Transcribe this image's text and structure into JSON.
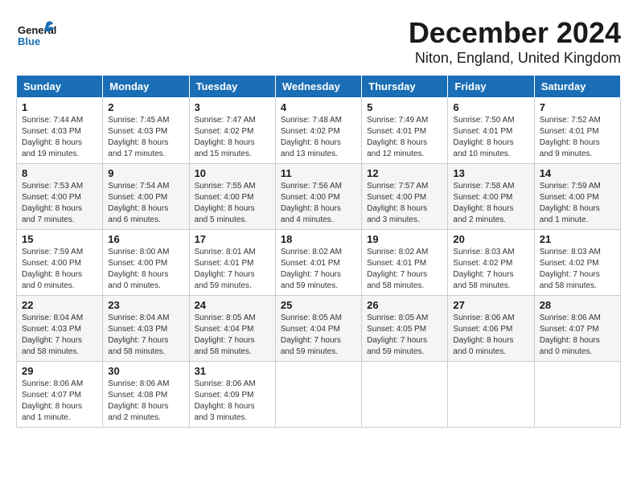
{
  "header": {
    "logo": {
      "general": "General",
      "blue": "Blue"
    },
    "month": "December 2024",
    "location": "Niton, England, United Kingdom"
  },
  "weekdays": [
    "Sunday",
    "Monday",
    "Tuesday",
    "Wednesday",
    "Thursday",
    "Friday",
    "Saturday"
  ],
  "weeks": [
    [
      {
        "day": "1",
        "sunrise": "Sunrise: 7:44 AM",
        "sunset": "Sunset: 4:03 PM",
        "daylight": "Daylight: 8 hours and 19 minutes."
      },
      {
        "day": "2",
        "sunrise": "Sunrise: 7:45 AM",
        "sunset": "Sunset: 4:03 PM",
        "daylight": "Daylight: 8 hours and 17 minutes."
      },
      {
        "day": "3",
        "sunrise": "Sunrise: 7:47 AM",
        "sunset": "Sunset: 4:02 PM",
        "daylight": "Daylight: 8 hours and 15 minutes."
      },
      {
        "day": "4",
        "sunrise": "Sunrise: 7:48 AM",
        "sunset": "Sunset: 4:02 PM",
        "daylight": "Daylight: 8 hours and 13 minutes."
      },
      {
        "day": "5",
        "sunrise": "Sunrise: 7:49 AM",
        "sunset": "Sunset: 4:01 PM",
        "daylight": "Daylight: 8 hours and 12 minutes."
      },
      {
        "day": "6",
        "sunrise": "Sunrise: 7:50 AM",
        "sunset": "Sunset: 4:01 PM",
        "daylight": "Daylight: 8 hours and 10 minutes."
      },
      {
        "day": "7",
        "sunrise": "Sunrise: 7:52 AM",
        "sunset": "Sunset: 4:01 PM",
        "daylight": "Daylight: 8 hours and 9 minutes."
      }
    ],
    [
      {
        "day": "8",
        "sunrise": "Sunrise: 7:53 AM",
        "sunset": "Sunset: 4:00 PM",
        "daylight": "Daylight: 8 hours and 7 minutes."
      },
      {
        "day": "9",
        "sunrise": "Sunrise: 7:54 AM",
        "sunset": "Sunset: 4:00 PM",
        "daylight": "Daylight: 8 hours and 6 minutes."
      },
      {
        "day": "10",
        "sunrise": "Sunrise: 7:55 AM",
        "sunset": "Sunset: 4:00 PM",
        "daylight": "Daylight: 8 hours and 5 minutes."
      },
      {
        "day": "11",
        "sunrise": "Sunrise: 7:56 AM",
        "sunset": "Sunset: 4:00 PM",
        "daylight": "Daylight: 8 hours and 4 minutes."
      },
      {
        "day": "12",
        "sunrise": "Sunrise: 7:57 AM",
        "sunset": "Sunset: 4:00 PM",
        "daylight": "Daylight: 8 hours and 3 minutes."
      },
      {
        "day": "13",
        "sunrise": "Sunrise: 7:58 AM",
        "sunset": "Sunset: 4:00 PM",
        "daylight": "Daylight: 8 hours and 2 minutes."
      },
      {
        "day": "14",
        "sunrise": "Sunrise: 7:59 AM",
        "sunset": "Sunset: 4:00 PM",
        "daylight": "Daylight: 8 hours and 1 minute."
      }
    ],
    [
      {
        "day": "15",
        "sunrise": "Sunrise: 7:59 AM",
        "sunset": "Sunset: 4:00 PM",
        "daylight": "Daylight: 8 hours and 0 minutes."
      },
      {
        "day": "16",
        "sunrise": "Sunrise: 8:00 AM",
        "sunset": "Sunset: 4:00 PM",
        "daylight": "Daylight: 8 hours and 0 minutes."
      },
      {
        "day": "17",
        "sunrise": "Sunrise: 8:01 AM",
        "sunset": "Sunset: 4:01 PM",
        "daylight": "Daylight: 7 hours and 59 minutes."
      },
      {
        "day": "18",
        "sunrise": "Sunrise: 8:02 AM",
        "sunset": "Sunset: 4:01 PM",
        "daylight": "Daylight: 7 hours and 59 minutes."
      },
      {
        "day": "19",
        "sunrise": "Sunrise: 8:02 AM",
        "sunset": "Sunset: 4:01 PM",
        "daylight": "Daylight: 7 hours and 58 minutes."
      },
      {
        "day": "20",
        "sunrise": "Sunrise: 8:03 AM",
        "sunset": "Sunset: 4:02 PM",
        "daylight": "Daylight: 7 hours and 58 minutes."
      },
      {
        "day": "21",
        "sunrise": "Sunrise: 8:03 AM",
        "sunset": "Sunset: 4:02 PM",
        "daylight": "Daylight: 7 hours and 58 minutes."
      }
    ],
    [
      {
        "day": "22",
        "sunrise": "Sunrise: 8:04 AM",
        "sunset": "Sunset: 4:03 PM",
        "daylight": "Daylight: 7 hours and 58 minutes."
      },
      {
        "day": "23",
        "sunrise": "Sunrise: 8:04 AM",
        "sunset": "Sunset: 4:03 PM",
        "daylight": "Daylight: 7 hours and 58 minutes."
      },
      {
        "day": "24",
        "sunrise": "Sunrise: 8:05 AM",
        "sunset": "Sunset: 4:04 PM",
        "daylight": "Daylight: 7 hours and 58 minutes."
      },
      {
        "day": "25",
        "sunrise": "Sunrise: 8:05 AM",
        "sunset": "Sunset: 4:04 PM",
        "daylight": "Daylight: 7 hours and 59 minutes."
      },
      {
        "day": "26",
        "sunrise": "Sunrise: 8:05 AM",
        "sunset": "Sunset: 4:05 PM",
        "daylight": "Daylight: 7 hours and 59 minutes."
      },
      {
        "day": "27",
        "sunrise": "Sunrise: 8:06 AM",
        "sunset": "Sunset: 4:06 PM",
        "daylight": "Daylight: 8 hours and 0 minutes."
      },
      {
        "day": "28",
        "sunrise": "Sunrise: 8:06 AM",
        "sunset": "Sunset: 4:07 PM",
        "daylight": "Daylight: 8 hours and 0 minutes."
      }
    ],
    [
      {
        "day": "29",
        "sunrise": "Sunrise: 8:06 AM",
        "sunset": "Sunset: 4:07 PM",
        "daylight": "Daylight: 8 hours and 1 minute."
      },
      {
        "day": "30",
        "sunrise": "Sunrise: 8:06 AM",
        "sunset": "Sunset: 4:08 PM",
        "daylight": "Daylight: 8 hours and 2 minutes."
      },
      {
        "day": "31",
        "sunrise": "Sunrise: 8:06 AM",
        "sunset": "Sunset: 4:09 PM",
        "daylight": "Daylight: 8 hours and 3 minutes."
      },
      null,
      null,
      null,
      null
    ]
  ]
}
